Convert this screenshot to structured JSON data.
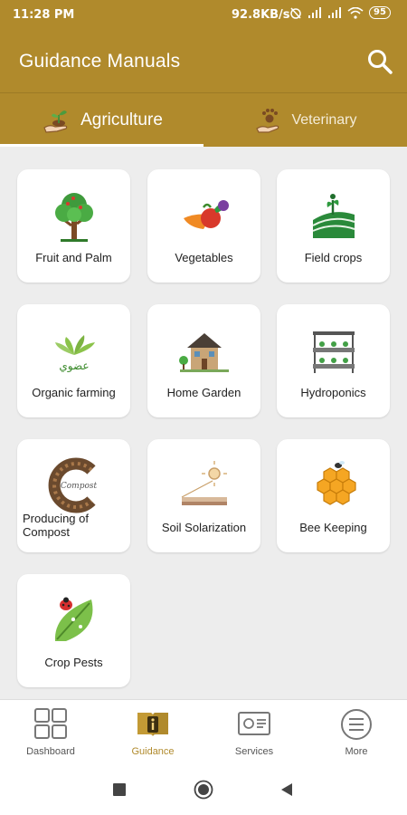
{
  "statusbar": {
    "time": "11:28 PM",
    "network": "92.8KB/s",
    "battery": "95"
  },
  "appbar": {
    "title": "Guidance Manuals",
    "search_icon": "search-icon"
  },
  "tabs": [
    {
      "label": "Agriculture",
      "icon": "plant-hand-icon",
      "selected": true
    },
    {
      "label": "Veterinary",
      "icon": "paw-hand-icon",
      "selected": false
    }
  ],
  "cards": [
    {
      "label": "Fruit and Palm",
      "icon": "tree-icon"
    },
    {
      "label": "Vegetables",
      "icon": "vegetables-icon"
    },
    {
      "label": "Field crops",
      "icon": "field-crops-icon"
    },
    {
      "label": "Organic farming",
      "icon": "organic-farming-icon",
      "icon_text": "عضوي"
    },
    {
      "label": "Home Garden",
      "icon": "house-garden-icon"
    },
    {
      "label": "Hydroponics",
      "icon": "hydroponics-icon"
    },
    {
      "label": "Producing of\nCompost",
      "icon": "compost-icon",
      "icon_text": "Compost"
    },
    {
      "label": "Soil Solarization",
      "icon": "soil-solarization-icon"
    },
    {
      "label": "Bee Keeping",
      "icon": "honeycomb-icon"
    },
    {
      "label": "Crop Pests",
      "icon": "ladybug-leaf-icon"
    }
  ],
  "bottomnav": [
    {
      "label": "Dashboard",
      "icon": "dashboard-grid-icon",
      "active": false
    },
    {
      "label": "Guidance",
      "icon": "book-info-icon",
      "active": true
    },
    {
      "label": "Services",
      "icon": "services-card-icon",
      "active": false
    },
    {
      "label": "More",
      "icon": "more-menu-icon",
      "active": false
    }
  ],
  "colors": {
    "primary": "#b08a2c",
    "background": "#ededed",
    "active_nav": "#b08a2c"
  }
}
